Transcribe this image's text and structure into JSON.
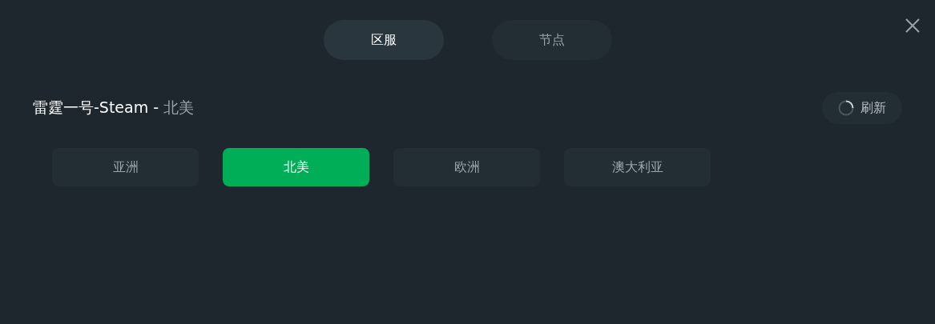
{
  "tabs": [
    {
      "label": "区服",
      "selected": true
    },
    {
      "label": "节点",
      "selected": false
    }
  ],
  "header": {
    "game": "雷霆一号-Steam -",
    "region": "北美"
  },
  "refresh_button": {
    "label": "刷新"
  },
  "regions": [
    {
      "label": "亚洲",
      "selected": false
    },
    {
      "label": "北美",
      "selected": true
    },
    {
      "label": "欧洲",
      "selected": false
    },
    {
      "label": "澳大利亚",
      "selected": false
    }
  ]
}
